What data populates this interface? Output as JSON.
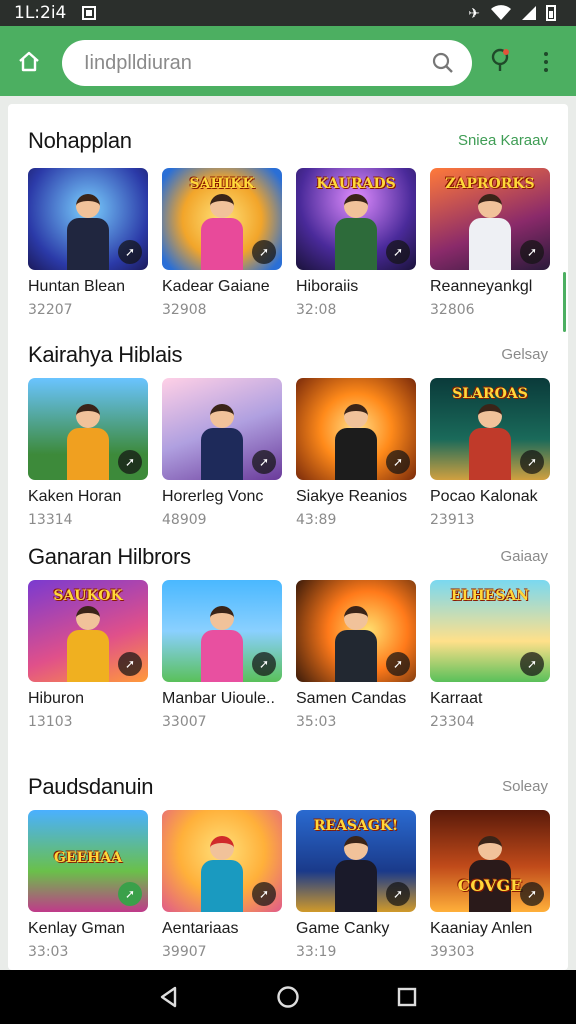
{
  "status_bar": {
    "time": "1L:2i4",
    "signal": "✈ ▾ ◢"
  },
  "search": {
    "placeholder": "Iindplldiuran"
  },
  "sections": [
    {
      "title": "Nohapplan",
      "link": "Sniea Karaav",
      "items": [
        {
          "title": "Huntan Blean",
          "meta": "32207"
        },
        {
          "title": "Kadear Gaiane",
          "meta": "32908"
        },
        {
          "title": "Hiboraiis",
          "meta": "32:08"
        },
        {
          "title": "Reanneyankgl",
          "meta": "32806"
        }
      ]
    },
    {
      "title": "Kairahya Hiblais",
      "link": "Gelsay",
      "items": [
        {
          "title": "Kaken Horan",
          "meta": "13314"
        },
        {
          "title": "Horerleg Vonc",
          "meta": "48909"
        },
        {
          "title": "Siakye Reanios",
          "meta": "43:89"
        },
        {
          "title": "Pocao Kalonak",
          "meta": "23913"
        }
      ]
    },
    {
      "title": "Ganaran Hilbrors",
      "link": "Gaiaay",
      "items": [
        {
          "title": "Hiburon",
          "meta": "13103"
        },
        {
          "title": "Manbar Uioule..",
          "meta": "33007"
        },
        {
          "title": "Samen Candas",
          "meta": "35:03"
        },
        {
          "title": "Karraat",
          "meta": "23304"
        }
      ]
    },
    {
      "title": "Paudsdanuin",
      "link": "Soleay",
      "items": [
        {
          "title": "Kenlay Gman",
          "meta": "33:03"
        },
        {
          "title": "Aentariaas",
          "meta": "39907"
        },
        {
          "title": "Game Canky",
          "meta": "33:19"
        },
        {
          "title": "Kaaniay Anlen",
          "meta": "39303"
        }
      ]
    }
  ],
  "thumb_banners": [
    "SAHIKK",
    "KAURADS",
    "ZAPRORKS",
    "SLAROAS",
    "SAUKOK",
    "ELHESAN",
    "GEEHAA",
    "REASAGK!",
    "COVGE"
  ],
  "colors": {
    "accent": "#4caf61",
    "link_green": "#3f9d55"
  }
}
